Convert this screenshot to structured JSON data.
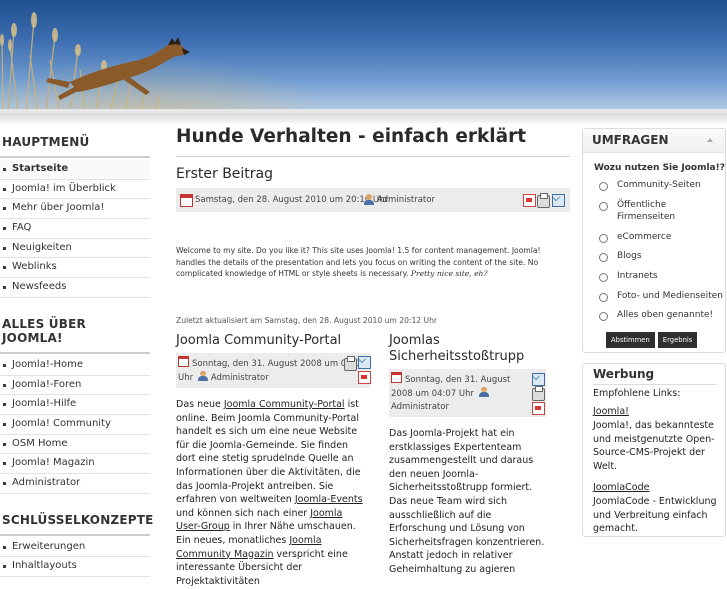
{
  "header": {
    "image_desc_icon": "dog-jumping-banner"
  },
  "left": {
    "menus": [
      {
        "title": "HAUPTMENÜ",
        "items": [
          "Startseite",
          "Joomla! im Überblick",
          "Mehr über Joomla!",
          "FAQ",
          "Neuigkeiten",
          "Weblinks",
          "Newsfeeds"
        ]
      },
      {
        "title": "ALLES ÜBER JOOMLA!",
        "items": [
          "Joomla!-Home",
          "Joomla!-Foren",
          "Joomla!-Hilfe",
          "Joomla! Community",
          "OSM Home",
          "Joomla! Magazin",
          "Administrator"
        ]
      },
      {
        "title": "SCHLÜSSELKONZEPTE",
        "items": [
          "Erweiterungen",
          "Inhaltlayouts"
        ]
      }
    ]
  },
  "main": {
    "page_title": "Hunde Verhalten - einfach erklärt",
    "article": {
      "title": "Erster Beitrag",
      "date": "Samstag, den 28. August 2010 um 20:10 Uhr",
      "author": "Administrator",
      "intro": "Welcome to my site. Do you like it? This site uses Joomla! 1.5 for content management. Joomla! handles the details of the presentation and lets you focus on writing the content of the site. No complicated knowledge of HTML or style sheets is necessary.",
      "intro_italic": "Pretty nice site, eh?",
      "modified": "Zuletzt aktualisiert am Samstag, den 28. August 2010 um 20:12 Uhr"
    },
    "col1": {
      "title": "Joomla Community-Portal",
      "date": "Sonntag, den 31. August 2008 um 04:07 Uhr",
      "author": "Administrator",
      "p1": "Das neue ",
      "link1": "Joomla Community-Portal",
      "p2": " ist online. Beim Joomla Community-Portal handelt es sich um eine neue Website für die Joomla-Gemeinde. Sie finden dort eine stetig sprudelnde Quelle an Informationen über die Aktivitäten, die das Joomla-Projekt antreiben. Sie erfahren von weltweiten ",
      "link2": "Joomla-Events",
      "p3": " und können sich nach einer ",
      "link3": "Joomla User-Group",
      "p4": " in Ihrer Nähe umschauen. Ein neues, monatliches ",
      "link4": "Joomla Community Magazin",
      "p5": " verspricht eine interessante Übersicht der Projektaktivitäten"
    },
    "col2": {
      "title": "Joomlas Sicherheitsstoßtrupp",
      "date": "Sonntag, den 31. August 2008 um 04:07 Uhr",
      "author": "Administrator",
      "body": "Das Joomla-Projekt hat ein erstklassiges Expertenteam zusammengestellt und daraus den neuen Joomla-Sicherheitsstoßtrupp formiert. Das neue Team wird sich ausschließlich auf die Erforschung und Lösung von Sicherheitsfragen konzentrieren. Anstatt jedoch in relativer Geheimhaltung zu agieren"
    }
  },
  "right": {
    "poll": {
      "title": "UMFRAGEN",
      "question": "Wozu nutzen Sie Joomla!?",
      "options": [
        "Community-Seiten",
        "Öffentliche Firmenseiten",
        "eCommerce",
        "Blogs",
        "Intranets",
        "Foto- und Medienseiten",
        "Alles oben genannte!"
      ],
      "vote_label": "Abstimmen",
      "results_label": "Ergebnis"
    },
    "ad": {
      "title": "Werbung",
      "intro": "Empfohlene Links:",
      "link1": "Joomla!",
      "desc1": "Joomla!, das bekannteste und meistgenutzte Open-Source-CMS-Projekt der Welt.",
      "link2": "JoomlaCode",
      "desc2": "JoomlaCode - Entwicklung und Verbreitung einfach gemacht."
    }
  }
}
